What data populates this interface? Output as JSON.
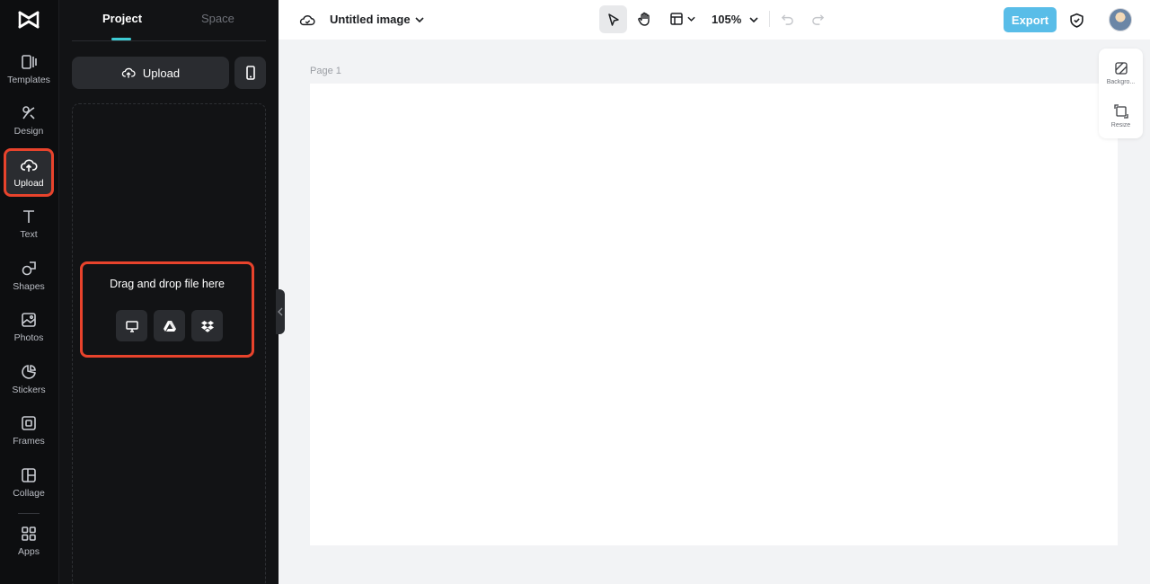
{
  "rail": {
    "items": [
      {
        "label": "Templates",
        "icon": "templates-icon"
      },
      {
        "label": "Design",
        "icon": "design-icon"
      },
      {
        "label": "Upload",
        "icon": "upload-cloud-icon"
      },
      {
        "label": "Text",
        "icon": "text-icon"
      },
      {
        "label": "Shapes",
        "icon": "shapes-icon"
      },
      {
        "label": "Photos",
        "icon": "photos-icon"
      },
      {
        "label": "Stickers",
        "icon": "stickers-icon"
      },
      {
        "label": "Frames",
        "icon": "frames-icon"
      },
      {
        "label": "Collage",
        "icon": "collage-icon"
      },
      {
        "label": "Apps",
        "icon": "apps-icon"
      }
    ],
    "active": "Upload"
  },
  "panel": {
    "tabs": [
      {
        "label": "Project"
      },
      {
        "label": "Space"
      }
    ],
    "upload_label": "Upload",
    "drop_text": "Drag and drop file here"
  },
  "topbar": {
    "title": "Untitled image",
    "zoom": "105%",
    "export_label": "Export"
  },
  "canvas": {
    "page_label": "Page 1"
  },
  "right_tools": [
    {
      "label": "Backgro...",
      "icon": "background-icon"
    },
    {
      "label": "Resize",
      "icon": "resize-icon"
    }
  ],
  "colors": {
    "accent": "#3ecbd4",
    "highlight": "#e8432c",
    "export": "#59bde8"
  }
}
